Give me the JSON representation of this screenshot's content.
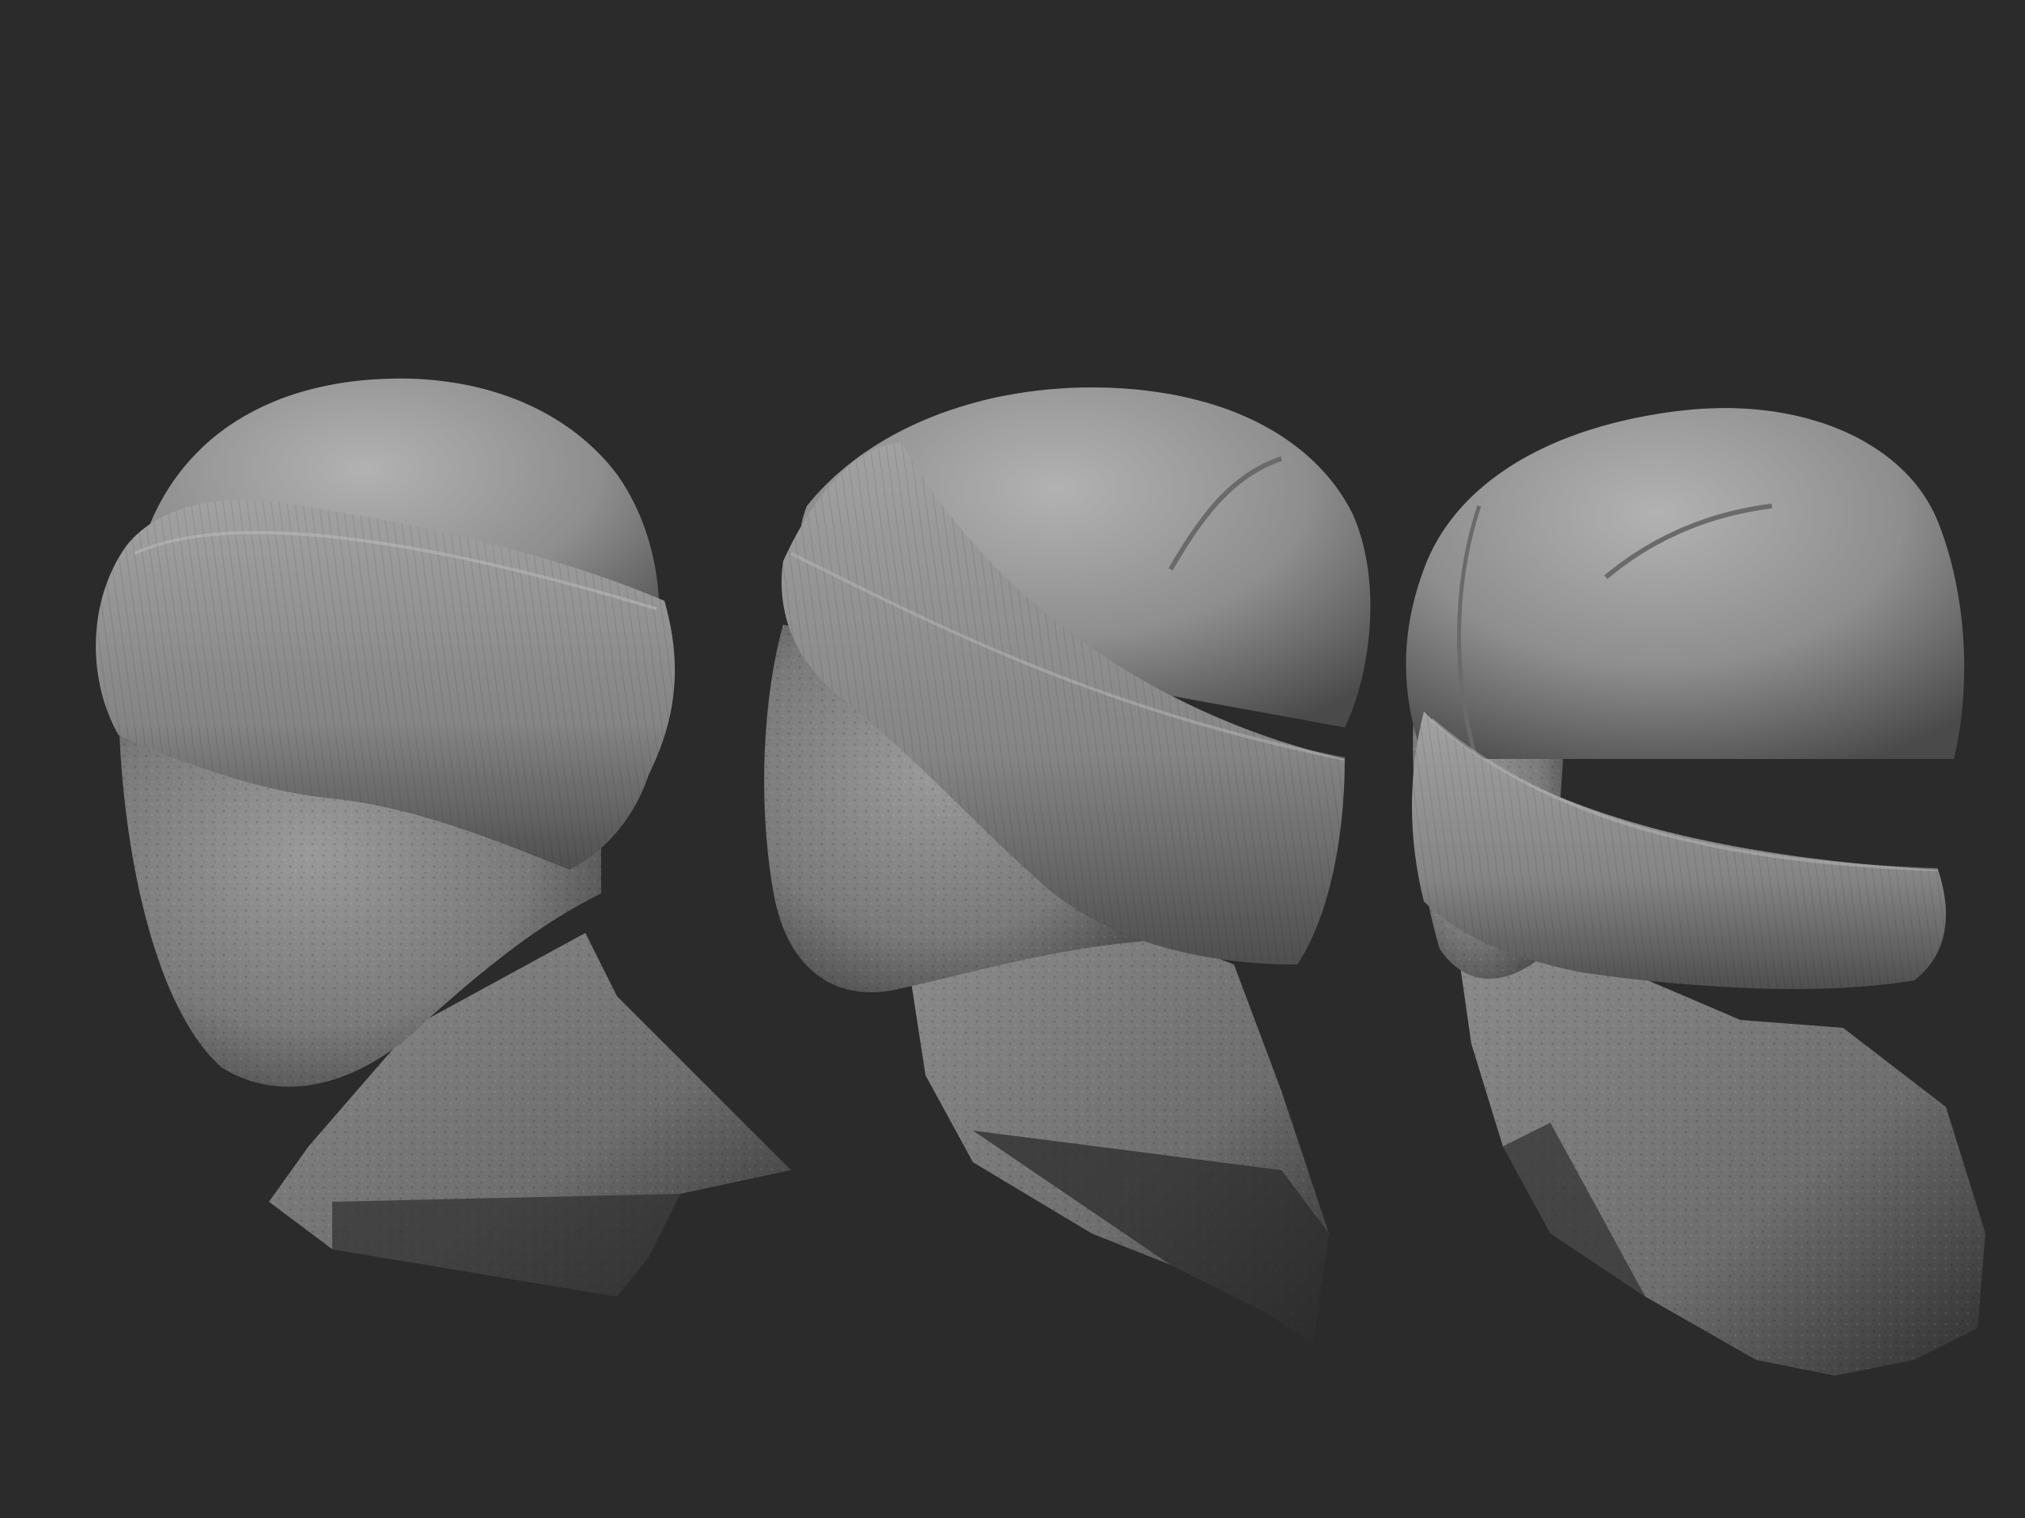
{
  "scene": {
    "background_color": "#2b2b2b",
    "material_color": "#8e8e8e",
    "models": [
      {
        "label": "",
        "view": "three-quarter-left",
        "object": "beanie-head-scan"
      },
      {
        "label": "",
        "view": "side-left",
        "object": "beanie-head-scan"
      },
      {
        "label": "",
        "view": "three-quarter-back-right",
        "object": "beanie-head-scan"
      }
    ]
  }
}
